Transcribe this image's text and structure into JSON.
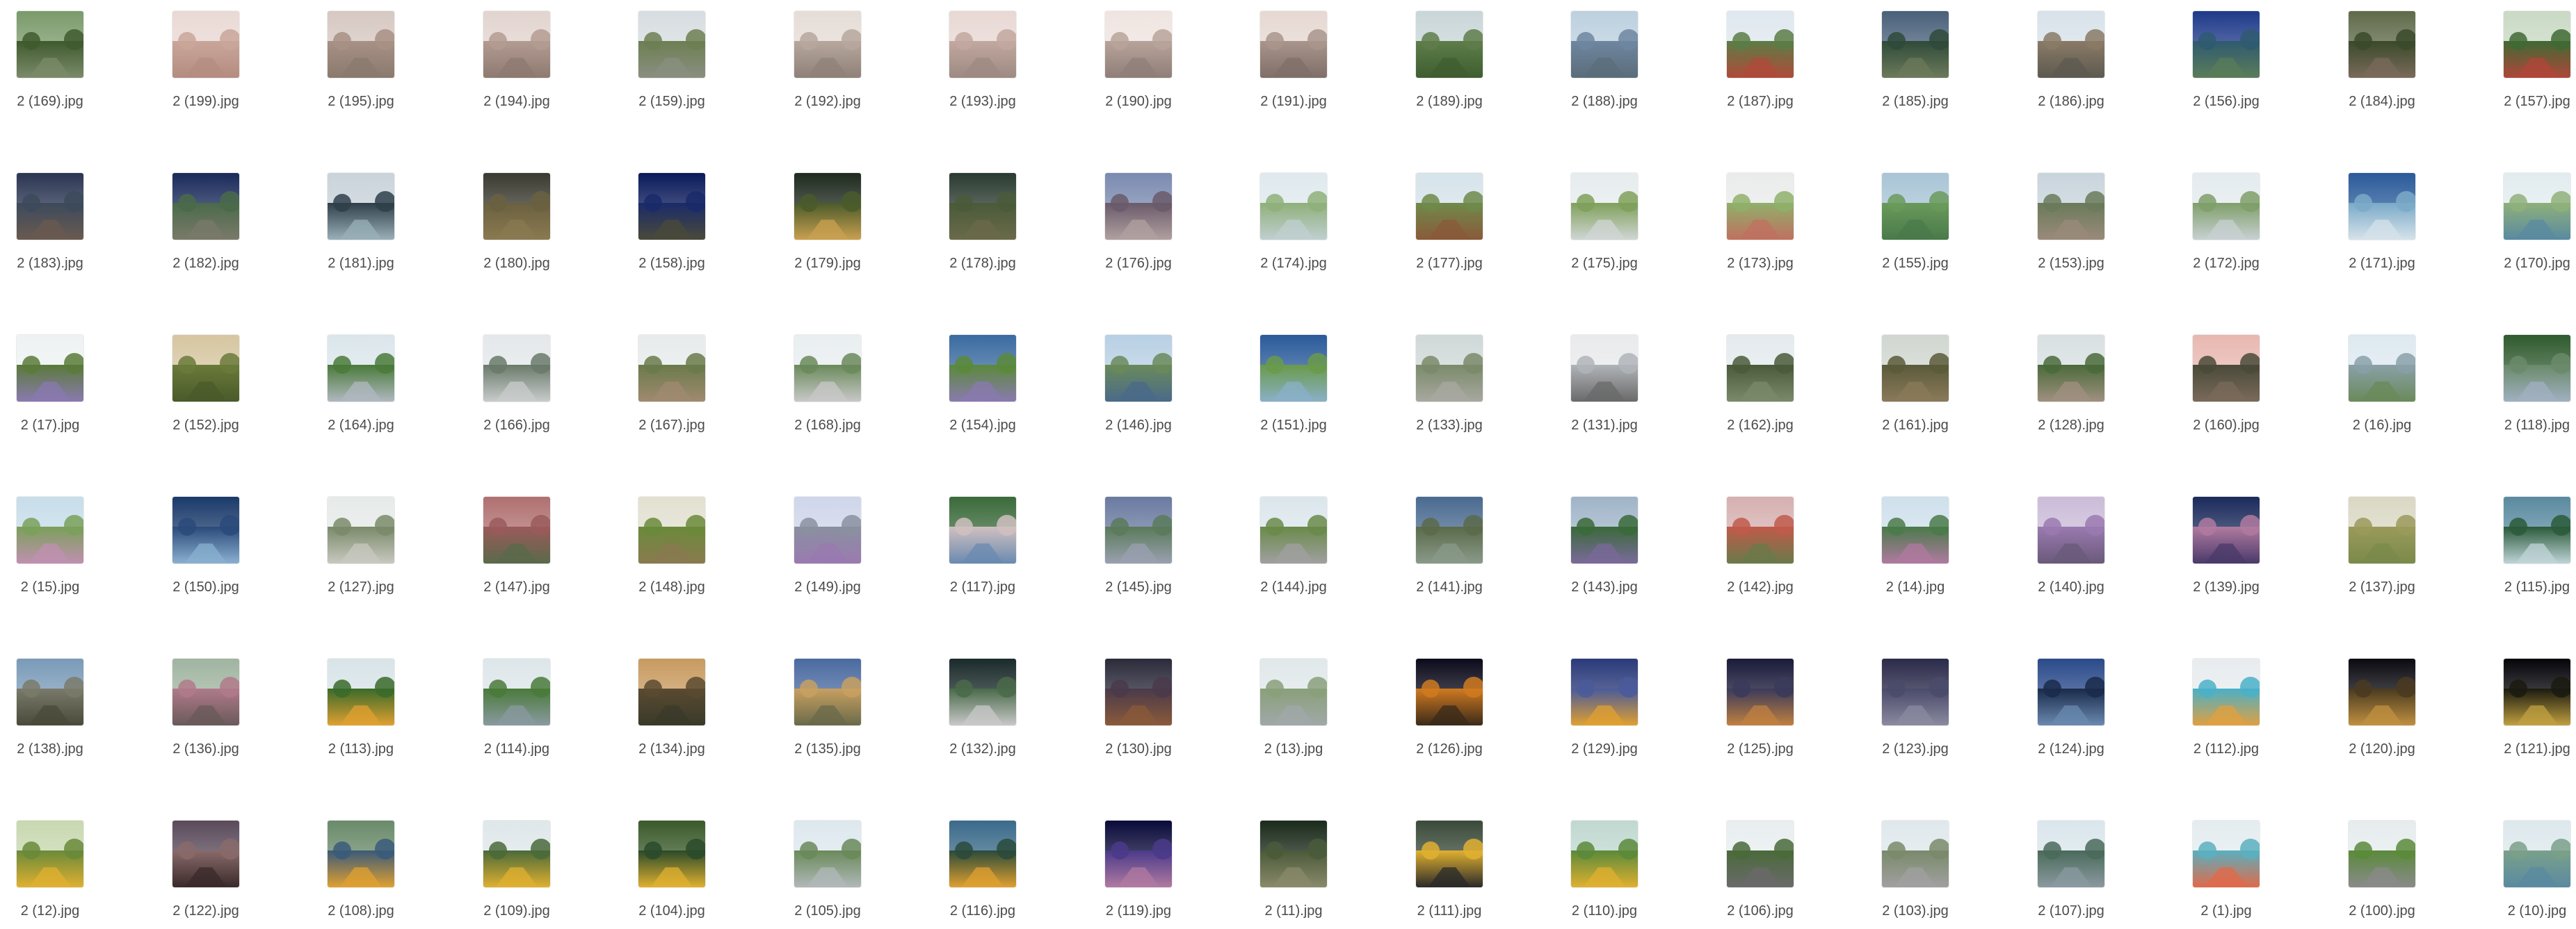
{
  "files": [
    [
      "2 (169).jpg",
      "2 (199).jpg",
      "2 (195).jpg",
      "2 (194).jpg",
      "2 (159).jpg",
      "2 (192).jpg",
      "2 (193).jpg",
      "2 (190).jpg",
      "2 (191).jpg",
      "2 (189).jpg",
      "2 (188).jpg",
      "2 (187).jpg",
      "2 (185).jpg",
      "2 (186).jpg",
      "2 (156).jpg",
      "2 (184).jpg",
      "2 (157).jpg"
    ],
    [
      "2 (183).jpg",
      "2 (182).jpg",
      "2 (181).jpg",
      "2 (180).jpg",
      "2 (158).jpg",
      "2 (179).jpg",
      "2 (178).jpg",
      "2 (176).jpg",
      "2 (174).jpg",
      "2 (177).jpg",
      "2 (175).jpg",
      "2 (173).jpg",
      "2 (155).jpg",
      "2 (153).jpg",
      "2 (172).jpg",
      "2 (171).jpg",
      "2 (170).jpg"
    ],
    [
      "2 (17).jpg",
      "2 (152).jpg",
      "2 (164).jpg",
      "2 (166).jpg",
      "2 (167).jpg",
      "2 (168).jpg",
      "2 (154).jpg",
      "2 (146).jpg",
      "2 (151).jpg",
      "2 (133).jpg",
      "2 (131).jpg",
      "2 (162).jpg",
      "2 (161).jpg",
      "2 (128).jpg",
      "2 (160).jpg",
      "2 (16).jpg",
      "2 (118).jpg"
    ],
    [
      "2 (15).jpg",
      "2 (150).jpg",
      "2 (127).jpg",
      "2 (147).jpg",
      "2 (148).jpg",
      "2 (149).jpg",
      "2 (117).jpg",
      "2 (145).jpg",
      "2 (144).jpg",
      "2 (141).jpg",
      "2 (143).jpg",
      "2 (142).jpg",
      "2 (14).jpg",
      "2 (140).jpg",
      "2 (139).jpg",
      "2 (137).jpg",
      "2 (115).jpg"
    ],
    [
      "2 (138).jpg",
      "2 (136).jpg",
      "2 (113).jpg",
      "2 (114).jpg",
      "2 (134).jpg",
      "2 (135).jpg",
      "2 (132).jpg",
      "2 (130).jpg",
      "2 (13).jpg",
      "2 (126).jpg",
      "2 (129).jpg",
      "2 (125).jpg",
      "2 (123).jpg",
      "2 (124).jpg",
      "2 (112).jpg",
      "2 (120).jpg",
      "2 (121).jpg"
    ],
    [
      "2 (12).jpg",
      "2 (122).jpg",
      "2 (108).jpg",
      "2 (109).jpg",
      "2 (104).jpg",
      "2 (105).jpg",
      "2 (116).jpg",
      "2 (119).jpg",
      "2 (11).jpg",
      "2 (111).jpg",
      "2 (110).jpg",
      "2 (106).jpg",
      "2 (103).jpg",
      "2 (107).jpg",
      "2 (1).jpg",
      "2 (100).jpg",
      "2 (10).jpg"
    ]
  ],
  "palettes": [
    [
      "#7a9a6a",
      "#3f5a2e",
      "#7b8b6a"
    ],
    [
      "#e9d9d4",
      "#c9a69a",
      "#b48c80"
    ],
    [
      "#d6c8c2",
      "#a89085",
      "#8a7a6e"
    ],
    [
      "#e2d4cf",
      "#b39b92",
      "#8e7a70"
    ],
    [
      "#d7dde0",
      "#6d7f52",
      "#8a8f80"
    ],
    [
      "#e5dcd6",
      "#b7a79d",
      "#8f8178"
    ],
    [
      "#e8d8d4",
      "#c2a8a0",
      "#9d8a82"
    ],
    [
      "#efe4e0",
      "#b8a39a",
      "#8f7f78"
    ],
    [
      "#e6d8d2",
      "#a9958c",
      "#7f6f68"
    ],
    [
      "#c9d6d8",
      "#5e7d4a",
      "#3f5e30"
    ],
    [
      "#bcd0df",
      "#6f86a0",
      "#5a6d7a"
    ],
    [
      "#dfe8ef",
      "#5c7d46",
      "#b04a3a"
    ],
    [
      "#49607a",
      "#2f4a3a",
      "#6c7a5a"
    ],
    [
      "#d8e2ea",
      "#8a7a66",
      "#5d5a50"
    ],
    [
      "#1f3a8a",
      "#2f5a70",
      "#5a7c5a"
    ],
    [
      "#5f6a4a",
      "#3a4a2a",
      "#7a6a5a"
    ],
    [
      "#c9d9c4",
      "#3f6a34",
      "#b0463a"
    ],
    [
      "#2b3552",
      "#3c4a5c",
      "#6a5a50"
    ],
    [
      "#1a2a5a",
      "#4a6a4a",
      "#7a7a6a"
    ],
    [
      "#c9d3da",
      "#2f3f4a",
      "#9ab0b8"
    ],
    [
      "#3a3a30",
      "#6a6040",
      "#8a7a50"
    ],
    [
      "#0a1a5a",
      "#1a2a6a",
      "#4a4a3a"
    ],
    [
      "#1e2a1e",
      "#4a5a2a",
      "#c9a050"
    ],
    [
      "#2a3a30",
      "#4a5a3a",
      "#6a6a4a"
    ],
    [
      "#7a8ab0",
      "#6a5a6a",
      "#b0a0a0"
    ],
    [
      "#dfe9ee",
      "#8fb07a",
      "#c0cfd0"
    ],
    [
      "#d6e3ea",
      "#6f8a4a",
      "#8a5a3a"
    ],
    [
      "#e6ecee",
      "#7fa05a",
      "#d0d6d4"
    ],
    [
      "#e9eceb",
      "#8fb06a",
      "#c07060"
    ],
    [
      "#a8c4d6",
      "#6a9a5a",
      "#4a7a4a"
    ],
    [
      "#c8d4dc",
      "#6a7a5a",
      "#9a8a7a"
    ],
    [
      "#e4ebee",
      "#7f9f6a",
      "#c8d0d2"
    ],
    [
      "#2a5a9a",
      "#7aaac8",
      "#d6e2ea"
    ],
    [
      "#e2ecef",
      "#8fb07a",
      "#5a8aa0"
    ],
    [
      "#eef2f2",
      "#5a7a3a",
      "#8a7ab0"
    ],
    [
      "#d6c6a0",
      "#6a7a3a",
      "#4a5a2a"
    ],
    [
      "#dbe6ec",
      "#4a7a3a",
      "#b0b8c0"
    ],
    [
      "#e4e8ea",
      "#6a7a6a",
      "#c8cccc"
    ],
    [
      "#e7ebec",
      "#6a7a4a",
      "#a08a70"
    ],
    [
      "#e9eef0",
      "#6a8a5a",
      "#c8c8c8"
    ],
    [
      "#3a6aa0",
      "#5a8a3a",
      "#8a7ab0"
    ],
    [
      "#b8d0e4",
      "#6a8a5a",
      "#4a6a8a"
    ],
    [
      "#2a5a9a",
      "#6a9a4a",
      "#8ab0c8"
    ],
    [
      "#cfd8d8",
      "#7a8a6a",
      "#a8a8a0"
    ],
    [
      "#e8eaec",
      "#b0b4b8",
      "#6a6a6a"
    ],
    [
      "#e4eaee",
      "#4a5a3a",
      "#7a8a6a"
    ],
    [
      "#d0d6d0",
      "#5a5a3a",
      "#8a7a5a"
    ],
    [
      "#d8e0e2",
      "#4a6a3a",
      "#a09080"
    ],
    [
      "#e8b8b0",
      "#4a4a3a",
      "#7a6a5a"
    ],
    [
      "#dde9f0",
      "#8aa0a8",
      "#6a8a5a"
    ],
    [
      "#2f5a2e",
      "#6a8a6a",
      "#a0b0c0"
    ],
    [
      "#c7ddea",
      "#7aa05a",
      "#c090b0"
    ],
    [
      "#1a3a6a",
      "#2a4a7a",
      "#8ab0d0"
    ],
    [
      "#e6eae8",
      "#7a8a6a",
      "#c8c8c0"
    ],
    [
      "#b07070",
      "#9a5a5a",
      "#5a6a4a"
    ],
    [
      "#e2e0d0",
      "#6a8a3a",
      "#8a7a50"
    ],
    [
      "#cfd6ea",
      "#8a90a0",
      "#9a7ab0"
    ],
    [
      "#3a6a3a",
      "#d0c0c0",
      "#6a8ab0"
    ],
    [
      "#6a7aa0",
      "#5a7a5a",
      "#9aa0b0"
    ],
    [
      "#dbe6ec",
      "#6a8a4a",
      "#a0a0a0"
    ],
    [
      "#4a6a90",
      "#5a6a4a",
      "#8a9a8a"
    ],
    [
      "#a0b4c8",
      "#3a6a3a",
      "#7a6a9a"
    ],
    [
      "#d6b0b0",
      "#c05a4a",
      "#6a7a4a"
    ],
    [
      "#cfe0ec",
      "#4a7a4a",
      "#b07aa0"
    ],
    [
      "#cbbcd8",
      "#9a7ab0",
      "#6a5a7a"
    ],
    [
      "#1a2a5a",
      "#b07aa0",
      "#4a3a6a"
    ],
    [
      "#dad8c4",
      "#9a9a5a",
      "#7a8a4a"
    ],
    [
      "#5a8aa0",
      "#2a5a3a",
      "#c0d4d8"
    ],
    [
      "#7a9ab8",
      "#7a7a6a",
      "#4a4a3a"
    ],
    [
      "#a0b4a0",
      "#b07a8a",
      "#6a5a5a"
    ],
    [
      "#d8e4e8",
      "#3a6a2a",
      "#e0a030"
    ],
    [
      "#dde6ea",
      "#4a7a3a",
      "#8a9aa0"
    ],
    [
      "#c89a60",
      "#5a4a30",
      "#3a3a2a"
    ],
    [
      "#4a6aa0",
      "#c8a060",
      "#6a6a4a"
    ],
    [
      "#1a2a2a",
      "#4a6a4a",
      "#c8c8c8"
    ],
    [
      "#2a2a3a",
      "#4a3a4a",
      "#8a5a3a"
    ],
    [
      "#e0e8ea",
      "#8aa07a",
      "#a0a8a8"
    ],
    [
      "#0a0a1a",
      "#d07a20",
      "#3a2a1a"
    ],
    [
      "#2a3a7a",
      "#4a5a9a",
      "#e0a030"
    ],
    [
      "#1a1a3a",
      "#3a3a5a",
      "#c08040"
    ],
    [
      "#2a2a4a",
      "#4a4a6a",
      "#8a8aa0"
    ],
    [
      "#2a4a8a",
      "#1a2a4a",
      "#6a8ab0"
    ],
    [
      "#e8ecee",
      "#4ab0c8",
      "#e0a040"
    ],
    [
      "#0a0a10",
      "#4a3a20",
      "#c09040"
    ],
    [
      "#05050a",
      "#1a1a10",
      "#c0a040"
    ],
    [
      "#c8d8b0",
      "#6a8a3a",
      "#e0b030"
    ],
    [
      "#5a4a5a",
      "#8a6a6a",
      "#3a2a2a"
    ],
    [
      "#6a8a6a",
      "#3a5a7a",
      "#e0a030"
    ],
    [
      "#dfe7ea",
      "#4a6a3a",
      "#e0b030"
    ],
    [
      "#3a5a2a",
      "#2a4a2a",
      "#e0b030"
    ],
    [
      "#dde8ee",
      "#6a8a5a",
      "#b0b8b8"
    ],
    [
      "#3a6a8a",
      "#2a4a3a",
      "#e0a030"
    ],
    [
      "#0a0a3a",
      "#4a3a8a",
      "#b07aa0"
    ],
    [
      "#1a2a1a",
      "#4a5a3a",
      "#8a8a6a"
    ],
    [
      "#3a4a3a",
      "#e0b030",
      "#2a2a2a"
    ],
    [
      "#c0d8d0",
      "#5a8a3a",
      "#e0b030"
    ],
    [
      "#e8eef0",
      "#4a6a3a",
      "#6a6a6a"
    ],
    [
      "#dfe8ec",
      "#7a8a6a",
      "#a0a0a0"
    ],
    [
      "#dae6ec",
      "#4a6a5a",
      "#8a9aa0"
    ],
    [
      "#e4ecef",
      "#5ab0c0",
      "#e06a4a"
    ],
    [
      "#e6ecee",
      "#5a8a3a",
      "#8a8a8a"
    ],
    [
      "#dde8ec",
      "#7aa08a",
      "#5a8aa0"
    ]
  ]
}
